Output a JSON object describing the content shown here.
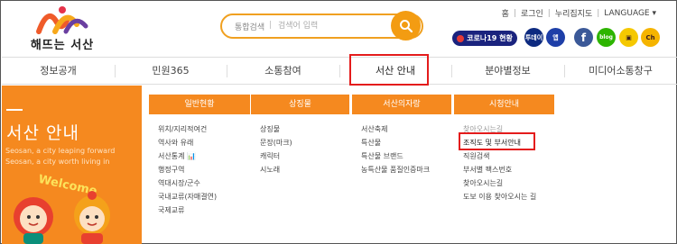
{
  "header": {
    "logo_text": "해뜨는 서산",
    "search": {
      "category": "통합검색",
      "placeholder": "검색어 입력"
    },
    "top_links": [
      "홈",
      "로그인",
      "누리집지도",
      "LANGUAGE ▾"
    ],
    "corona_label": "코로나19 현황",
    "sns": [
      {
        "label": "투데이",
        "color": "#0d2a80",
        "icon": "today-news-icon"
      },
      {
        "label": "앱",
        "color": "#1e3fa8",
        "icon": "app-icon"
      },
      {
        "label": "f",
        "color": "#3b5998",
        "icon": "facebook-icon"
      },
      {
        "label": "blog",
        "color": "#2db400",
        "icon": "blog-icon"
      },
      {
        "label": "▣",
        "color": "#f5c800",
        "icon": "chat-icon"
      },
      {
        "label": "Ch",
        "color": "#f5b400",
        "icon": "channel-icon"
      }
    ],
    "colors": {
      "accent": "#f39c12",
      "highlight": "#e41c1c"
    }
  },
  "nav": {
    "items": [
      "정보공개",
      "민원365",
      "소통참여",
      "서산 안내",
      "분야별정보",
      "미디어소통창구"
    ]
  },
  "left_panel": {
    "title": "서산 안내",
    "sub1": "Seosan, a city leaping forward",
    "sub2": "Seosan, a city worth living in",
    "welcome": "Welcome"
  },
  "menu": {
    "columns": [
      {
        "title": "일반현황",
        "items": [
          "위치/지리적여건",
          "역사와 유래",
          "서산통계",
          "행정구역",
          "역대시장/군수",
          "국내교류(자매결연)",
          "국제교류"
        ]
      },
      {
        "title": "상징물",
        "items": [
          "상징물",
          "문장(마크)",
          "캐릭터",
          "시노래"
        ]
      },
      {
        "title": "서산의자랑",
        "items": [
          "서산축제",
          "특산물",
          "특산물 브랜드",
          "농특산물 품질인증마크"
        ]
      },
      {
        "title": "시청안내",
        "items": [
          "찾아오시는길",
          "조직도 및 부서안내",
          "직원검색",
          "부서별 팩스번호",
          "찾아오시는길",
          "도보 이용 찾아오시는 길"
        ]
      }
    ]
  }
}
